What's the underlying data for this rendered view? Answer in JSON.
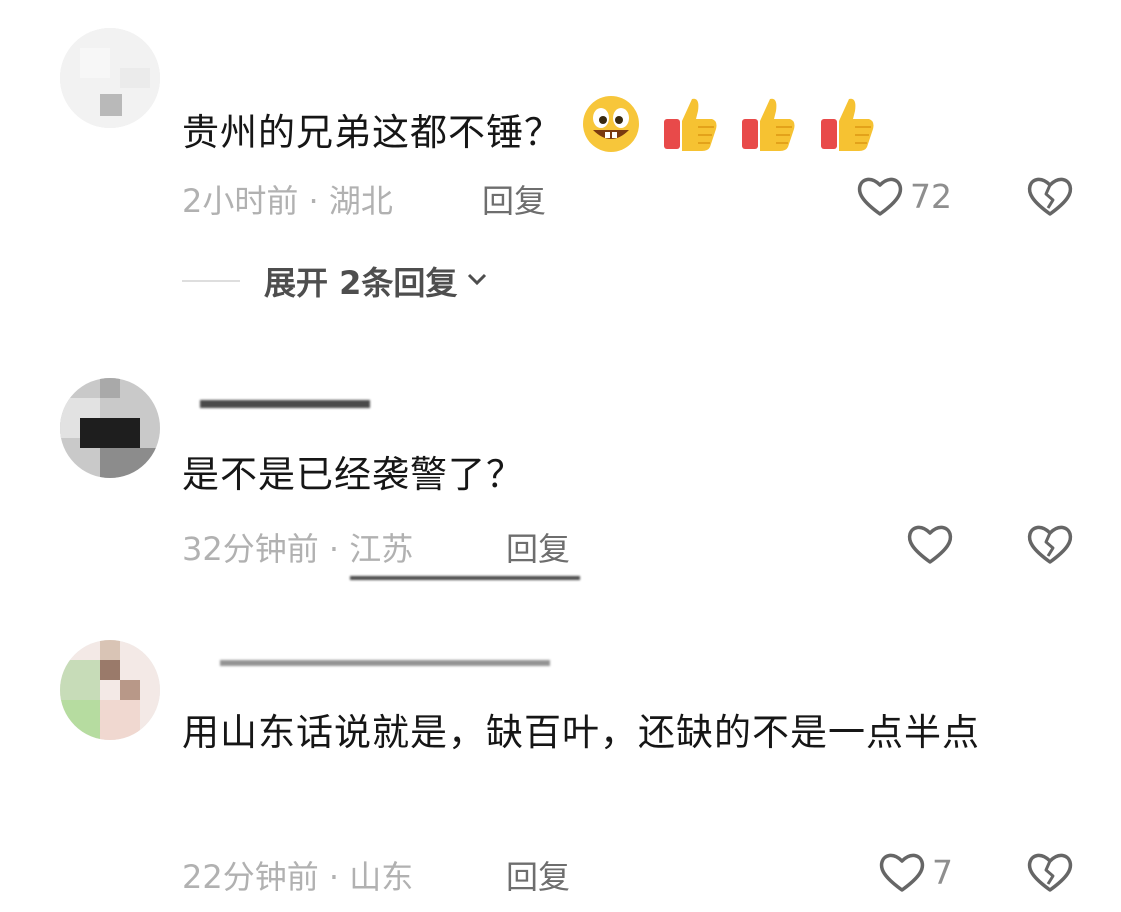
{
  "comments": [
    {
      "username": "",
      "text": "贵州的兄弟这都不锤？",
      "emojis": [
        "grinning-face-icon",
        "thumbs-up-icon",
        "thumbs-up-icon",
        "thumbs-up-icon"
      ],
      "meta": "2小时前 · 湖北",
      "reply_label": "回复",
      "like_count": "72",
      "expand_label": "展开 2条回复"
    },
    {
      "username": "",
      "text": "是不是已经袭警了？",
      "meta": "32分钟前 · 江苏",
      "reply_label": "回复",
      "like_count": ""
    },
    {
      "username": "",
      "text": "用山东话说就是，缺百叶，还缺的不是一点半点",
      "meta": "22分钟前 · 山东",
      "reply_label": "回复",
      "like_count": "7"
    }
  ],
  "icons": {
    "like": "heart-outline-icon",
    "dislike": "broken-heart-icon",
    "chevron": "chevron-down-icon"
  },
  "colors": {
    "text": "#161616",
    "meta": "#b1b1b1",
    "reply": "#6e6e6e",
    "icon": "#666666"
  }
}
